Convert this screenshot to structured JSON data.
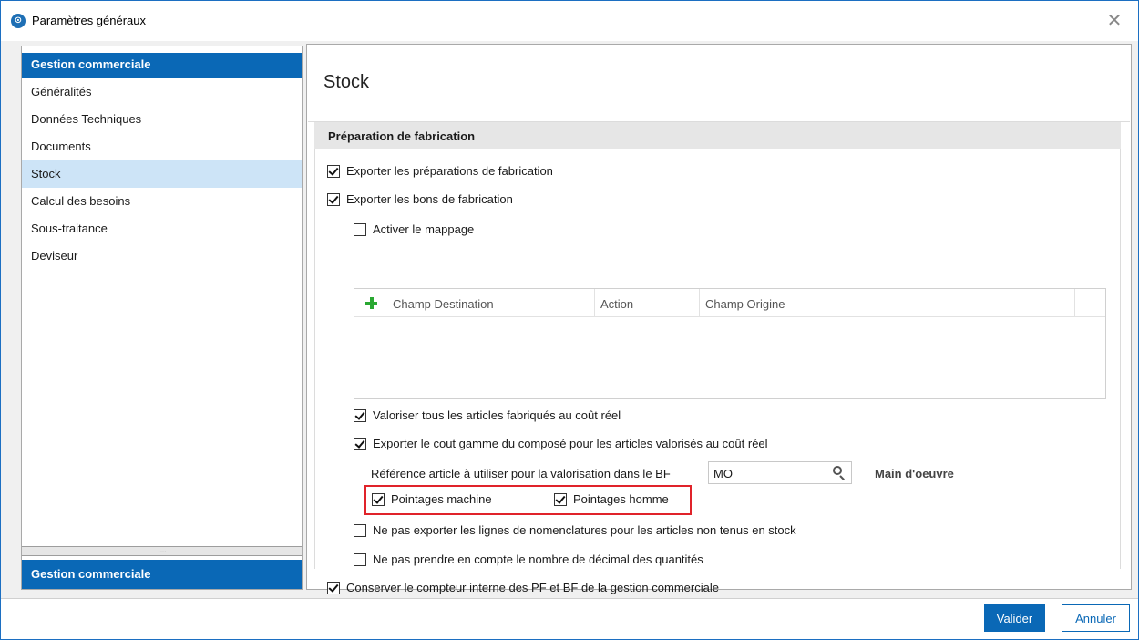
{
  "window": {
    "title": "Paramètres généraux",
    "close_glyph": "✕"
  },
  "sidebar": {
    "header": "Gestion commerciale",
    "items": [
      {
        "label": "Généralités",
        "active": false
      },
      {
        "label": "Données Techniques",
        "active": false
      },
      {
        "label": "Documents",
        "active": false
      },
      {
        "label": "Stock",
        "active": true
      },
      {
        "label": "Calcul des besoins",
        "active": false
      },
      {
        "label": "Sous-traitance",
        "active": false
      },
      {
        "label": "Deviseur",
        "active": false
      }
    ],
    "splitter_grip": ".....",
    "footer": "Gestion commerciale"
  },
  "main": {
    "title": "Stock",
    "section": "Préparation de fabrication",
    "options": {
      "export_preparations": {
        "label": "Exporter les préparations de fabrication",
        "checked": true
      },
      "export_bons": {
        "label": "Exporter les bons de fabrication",
        "checked": true
      },
      "activer_mappage": {
        "label": "Activer le mappage",
        "checked": false
      },
      "valoriser": {
        "label": "Valoriser tous les articles fabriqués au coût réel",
        "checked": true
      },
      "exporter_cout": {
        "label": "Exporter le cout gamme du composé pour les articles valorisés au coût réel",
        "checked": true
      },
      "pointages_machine": {
        "label": "Pointages machine",
        "checked": true
      },
      "pointages_homme": {
        "label": "Pointages homme",
        "checked": true
      },
      "ne_pas_exporter": {
        "label": "Ne pas exporter les lignes de nomenclatures pour les articles non tenus en stock",
        "checked": false
      },
      "ne_pas_prendre": {
        "label": "Ne pas prendre en compte le nombre de décimal des quantités",
        "checked": false
      },
      "conserver": {
        "label": "Conserver le compteur interne des PF et BF de la gestion commerciale",
        "checked": true
      }
    },
    "mapping_grid": {
      "columns": [
        "Champ Destination",
        "Action",
        "Champ Origine"
      ],
      "rows": []
    },
    "reference": {
      "label": "Référence article à utiliser pour la valorisation dans le BF",
      "value": "MO",
      "description": "Main d'oeuvre"
    }
  },
  "footer": {
    "validate": "Valider",
    "cancel": "Annuler"
  },
  "colors": {
    "accent": "#0a68b6",
    "selection": "#cde4f7",
    "highlight": "#e0232a",
    "add_icon": "#2aa832"
  }
}
